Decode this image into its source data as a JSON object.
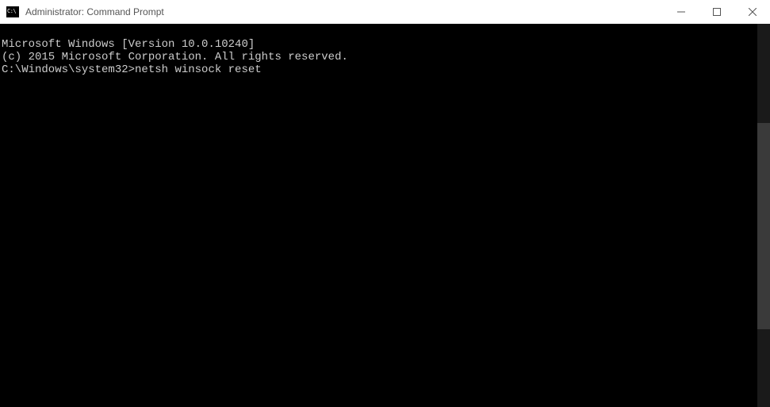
{
  "window": {
    "title": "Administrator: Command Prompt"
  },
  "terminal": {
    "line1": "Microsoft Windows [Version 10.0.10240]",
    "line2": "(c) 2015 Microsoft Corporation. All rights reserved.",
    "blank": "",
    "prompt": "C:\\Windows\\system32>",
    "command": "netsh winsock reset"
  }
}
